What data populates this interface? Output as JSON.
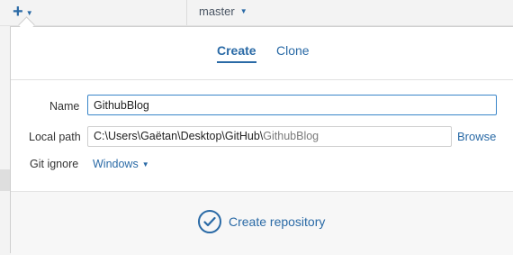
{
  "toolbar": {
    "add_icon": "plus-icon",
    "branch_label": "master"
  },
  "tabs": [
    {
      "label": "Create",
      "active": true
    },
    {
      "label": "Clone",
      "active": false
    }
  ],
  "form": {
    "name_label": "Name",
    "name_value": "GithubBlog",
    "local_path_label": "Local path",
    "local_path_prefix": "C:\\Users\\Gaëtan\\Desktop\\GitHub\\",
    "local_path_suffix": "GithubBlog",
    "browse_label": "Browse",
    "git_ignore_label": "Git ignore",
    "git_ignore_value": "Windows"
  },
  "footer": {
    "create_label": "Create repository",
    "icon": "check-circle-icon"
  },
  "colors": {
    "accent": "#2a6aa6",
    "input_focus": "#3a86c9"
  }
}
